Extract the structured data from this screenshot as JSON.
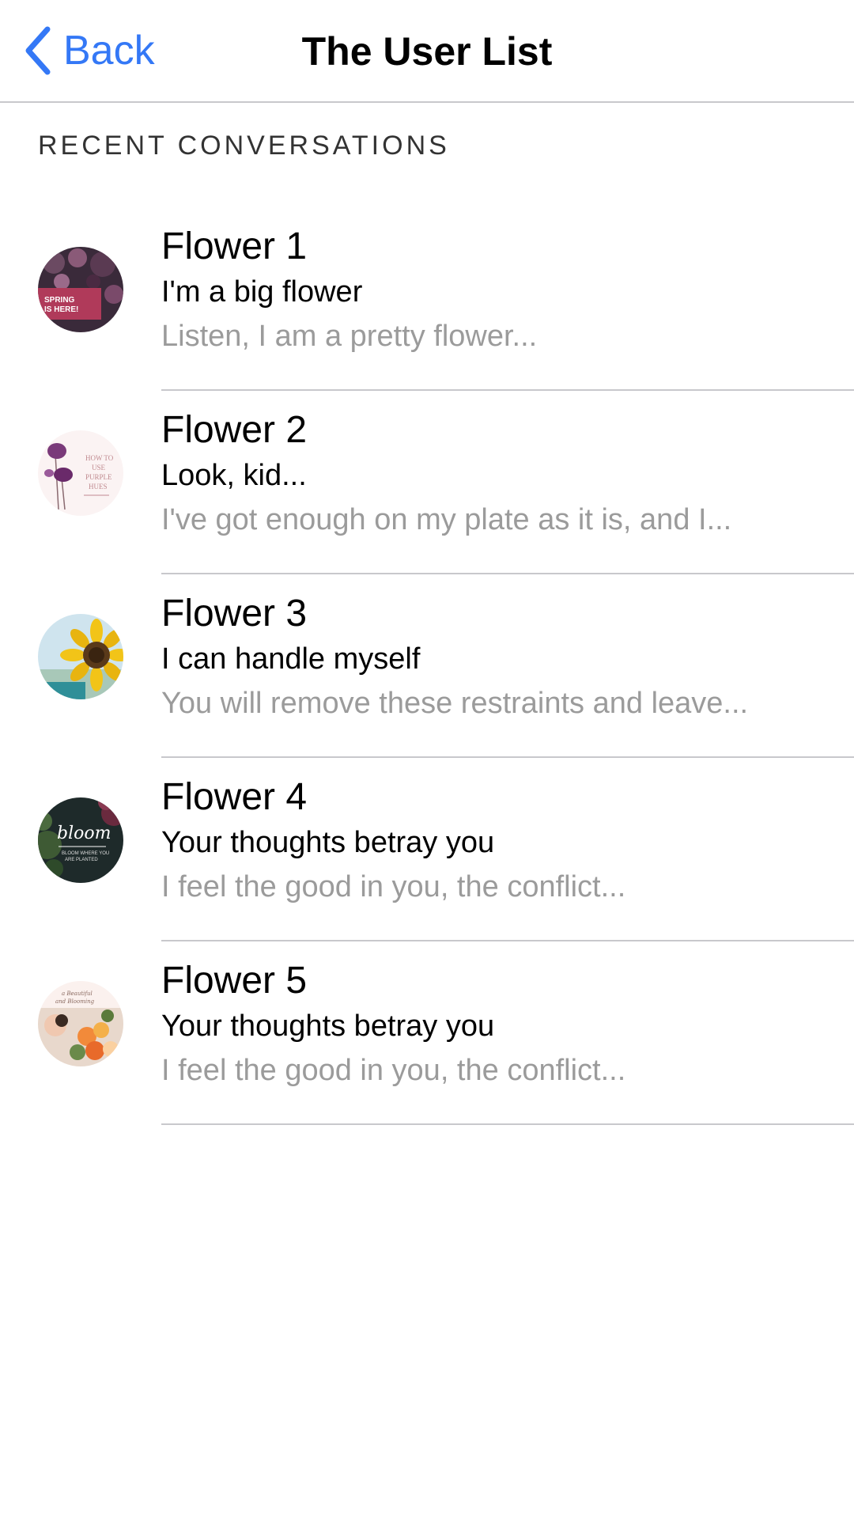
{
  "nav": {
    "back_label": "Back",
    "title": "The User List"
  },
  "section": {
    "header": "RECENT CONVERSATIONS"
  },
  "conversations": [
    {
      "name": "Flower 1",
      "subtitle": "I'm a big flower",
      "preview": "Listen, I am a pretty flower...",
      "avatar_text": "SPRING IS HERE!"
    },
    {
      "name": "Flower 2",
      "subtitle": "Look, kid...",
      "preview": "I've got enough on my plate as it is, and I...",
      "avatar_text": "HOW TO USE PURPLE HUES"
    },
    {
      "name": "Flower 3",
      "subtitle": "I can handle myself",
      "preview": "You will remove these restraints and leave..."
    },
    {
      "name": "Flower 4",
      "subtitle": "Your thoughts betray you",
      "preview": "I feel the good in you, the conflict...",
      "avatar_text": "bloom"
    },
    {
      "name": "Flower 5",
      "subtitle": "Your thoughts betray you",
      "preview": "I feel the good in you, the conflict..."
    }
  ],
  "colors": {
    "accent": "#3478f6",
    "separator": "#c8c8cc",
    "secondary_text": "#9b9b9b"
  },
  "icons": {
    "back": "chevron-left-icon"
  }
}
